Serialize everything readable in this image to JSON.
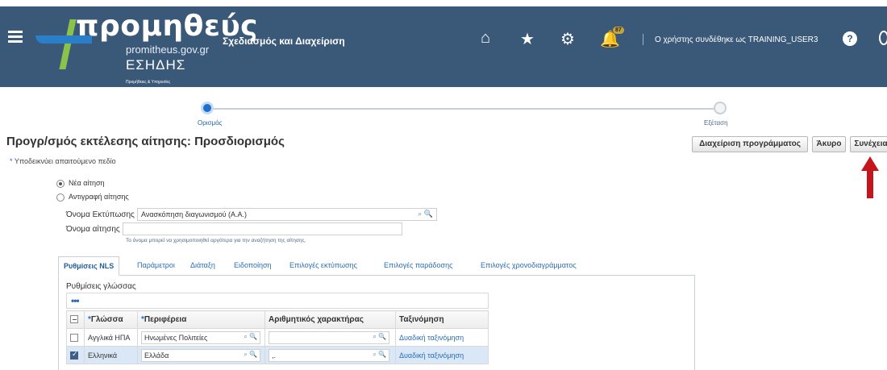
{
  "header": {
    "logo_name": "προμηθεύς",
    "logo_domain": "promitheus.gov.gr",
    "logo_eshds": "ΕΣΗΔΗΣ",
    "logo_small": "Προμήθειες & Υπηρεσίες",
    "app_title": "Σχεδιασμός και Διαχείριση",
    "notification_count": "87",
    "user_text": "Ο χρήστης συνδέθηκε ως TRAINING_USER3"
  },
  "train": {
    "step1": "Ορισμός",
    "step2": "Εξέταση"
  },
  "page": {
    "title": "Προγρ/σμός εκτέλεσης αίτησης: Προσδιορισμός",
    "required_note": "Υποδεικνύει απαιτούμενο πεδίο"
  },
  "buttons": {
    "manage": "Διαχείριση προγράμματος",
    "cancel": "Άκυρο",
    "continue": "Συνέχεια"
  },
  "radios": {
    "new_request": "Νέα αίτηση",
    "copy_request": "Αντιγραφή αίτησης"
  },
  "fields": {
    "print_name_label": "Όνομα Εκτύπωσης",
    "print_name_value": "Ανασκόπηση διαγωνισμού (Α.Α.)",
    "request_name_label": "Όνομα αίτησης",
    "request_name_value": "",
    "hint": "Το όνομα μπορεί να χρησιμοποιηθεί αργότερα για την αναζήτηση της αίτησης."
  },
  "tabs": [
    "Ρυθμίσεις NLS",
    "Παράμετροι",
    "Διάταξη",
    "Ειδοποίηση",
    "Επιλογές εκτύπωσης",
    "Επιλογές παράδοσης",
    "Επιλογές χρονοδιαγράμματος"
  ],
  "language_panel": {
    "title": "Ρυθμίσεις γλώσσας",
    "columns": [
      "Γλώσσα",
      "Περιφέρεια",
      "Αριθμητικός χαρακτήρας",
      "Ταξινόμηση"
    ],
    "rows": [
      {
        "language": "Αγγλικά ΗΠΑ",
        "territory": "Ηνωμένες Πολιτείες",
        "numeric": "",
        "sort": "Δυαδική ταξινόμηση",
        "checked": false
      },
      {
        "language": "Ελληνικά",
        "territory": "Ελλάδα",
        "numeric": ",.",
        "sort": "Δυαδική ταξινόμηση",
        "checked": true
      }
    ]
  }
}
